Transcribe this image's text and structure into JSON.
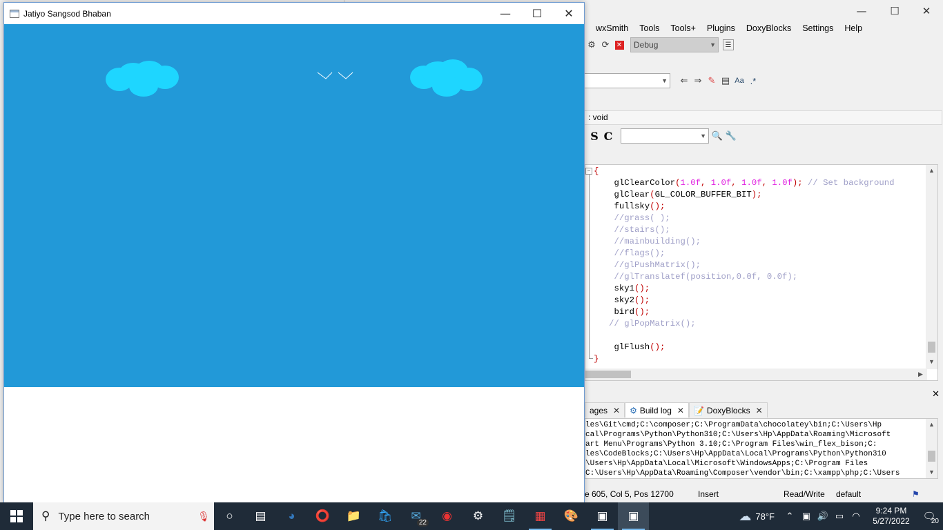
{
  "ide": {
    "menu": [
      "wxSmith",
      "Tools",
      "Tools+",
      "Plugins",
      "DoxyBlocks",
      "Settings",
      "Help"
    ],
    "build_target": "Debug",
    "symbol": ": void",
    "bold_s": "S",
    "bold_c": "C",
    "code_lines": [
      {
        "spans": [
          {
            "t": "{",
            "c": "k-red"
          }
        ]
      },
      {
        "spans": [
          {
            "t": "    glClearColor",
            "c": "k-plain"
          },
          {
            "t": "(",
            "c": "k-red"
          },
          {
            "t": "1.0f",
            "c": "k-num"
          },
          {
            "t": ", ",
            "c": "k-red"
          },
          {
            "t": "1.0f",
            "c": "k-num"
          },
          {
            "t": ", ",
            "c": "k-red"
          },
          {
            "t": "1.0f",
            "c": "k-num"
          },
          {
            "t": ", ",
            "c": "k-red"
          },
          {
            "t": "1.0f",
            "c": "k-num"
          },
          {
            "t": "); ",
            "c": "k-red"
          },
          {
            "t": "// Set background",
            "c": "k-cmt"
          }
        ]
      },
      {
        "spans": [
          {
            "t": "    glClear",
            "c": "k-plain"
          },
          {
            "t": "(",
            "c": "k-red"
          },
          {
            "t": "GL_COLOR_BUFFER_BIT",
            "c": "k-plain"
          },
          {
            "t": ");",
            "c": "k-red"
          }
        ]
      },
      {
        "spans": [
          {
            "t": "    fullsky",
            "c": "k-plain"
          },
          {
            "t": "();",
            "c": "k-red"
          }
        ]
      },
      {
        "spans": [
          {
            "t": "    //grass( );",
            "c": "k-cmt"
          }
        ]
      },
      {
        "spans": [
          {
            "t": "    //stairs();",
            "c": "k-cmt"
          }
        ]
      },
      {
        "spans": [
          {
            "t": "    //mainbuilding();",
            "c": "k-cmt"
          }
        ]
      },
      {
        "spans": [
          {
            "t": "    //flags();",
            "c": "k-cmt"
          }
        ]
      },
      {
        "spans": [
          {
            "t": "    //glPushMatrix();",
            "c": "k-cmt"
          }
        ]
      },
      {
        "spans": [
          {
            "t": "    //glTranslatef(position,0.0f, 0.0f);",
            "c": "k-cmt"
          }
        ]
      },
      {
        "spans": [
          {
            "t": "    sky1",
            "c": "k-plain"
          },
          {
            "t": "();",
            "c": "k-red"
          }
        ]
      },
      {
        "spans": [
          {
            "t": "    sky2",
            "c": "k-plain"
          },
          {
            "t": "();",
            "c": "k-red"
          }
        ]
      },
      {
        "spans": [
          {
            "t": "    bird",
            "c": "k-plain"
          },
          {
            "t": "();",
            "c": "k-red"
          }
        ]
      },
      {
        "spans": [
          {
            "t": "   // glPopMatrix();",
            "c": "k-cmt"
          }
        ]
      },
      {
        "spans": [
          {
            "t": "",
            "c": "k-plain"
          }
        ]
      },
      {
        "spans": [
          {
            "t": "    glFlush",
            "c": "k-plain"
          },
          {
            "t": "();",
            "c": "k-red"
          }
        ]
      },
      {
        "spans": [
          {
            "t": "}",
            "c": "k-red"
          }
        ]
      }
    ],
    "log_tabs": [
      {
        "label": "ages",
        "active": false
      },
      {
        "label": "Build log",
        "active": true
      },
      {
        "label": "DoxyBlocks",
        "active": false
      }
    ],
    "log_lines": [
      "les\\Git\\cmd;C:\\composer;C:\\ProgramData\\chocolatey\\bin;C:\\Users\\Hp",
      "cal\\Programs\\Python\\Python310;C:\\Users\\Hp\\AppData\\Roaming\\Microsoft",
      "art Menu\\Programs\\Python 3.10;C:\\Program Files\\win_flex_bison;C:",
      "les\\CodeBlocks;C:\\Users\\Hp\\AppData\\Local\\Programs\\Python\\Python310",
      "\\Users\\Hp\\AppData\\Local\\Microsoft\\WindowsApps;C:\\Program Files",
      "C:\\Users\\Hp\\AppData\\Roaming\\Composer\\vendor\\bin;C:\\xampp\\php;C:\\Users"
    ],
    "status": {
      "position": "e 605, Col 5, Pos 12700",
      "mode": "Insert",
      "access": "Read/Write",
      "profile": "default"
    }
  },
  "glwin": {
    "title": "Jatiyo Sangsod Bhaban",
    "sky_color": "#2299d8",
    "cloud_color": "#1ed6ff",
    "bird_color": "#ffffff"
  },
  "taskbar": {
    "search_placeholder": "Type here to search",
    "mail_badge": "22",
    "weather": "78°F",
    "time": "9:24 PM",
    "date": "5/27/2022",
    "notifications": "20",
    "icons": [
      "cortana-icon",
      "task-view-icon",
      "edge-icon",
      "opera-icon",
      "file-explorer-icon",
      "store-icon",
      "mail-icon",
      "chrome-icon",
      "settings-icon",
      "notepad-icon",
      "codeblocks-icon",
      "paint-icon",
      "app-window-icon",
      "app-window-active-icon"
    ]
  }
}
